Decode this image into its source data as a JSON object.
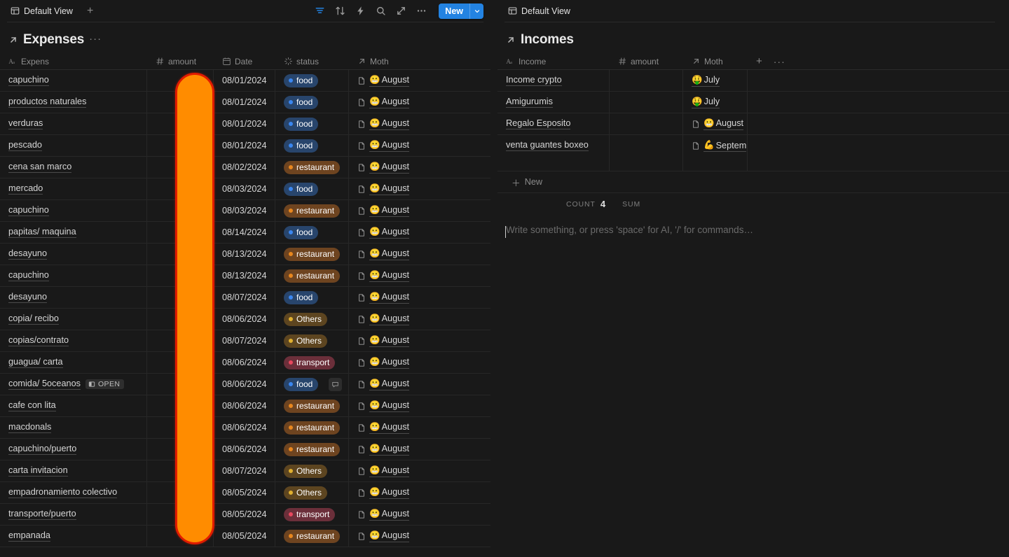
{
  "left": {
    "toolbar": {
      "view_label": "Default View",
      "add_view_label": "+",
      "new_button_label": "New",
      "icons": [
        "filter-icon",
        "sort-icon",
        "automation-icon",
        "search-icon",
        "expand-icon",
        "more-icon"
      ]
    },
    "database": {
      "title": "Expenses",
      "more_label": "···"
    },
    "columns": [
      {
        "label": "Expens",
        "icon": "text-type-icon"
      },
      {
        "label": "amount",
        "icon": "number-type-icon"
      },
      {
        "label": "Date",
        "icon": "date-type-icon"
      },
      {
        "label": "status",
        "icon": "select-type-icon"
      },
      {
        "label": "Moth",
        "icon": "relation-type-icon"
      }
    ],
    "rows": [
      {
        "name": "capuchino",
        "amount": "",
        "date": "08/01/2024",
        "status": "food",
        "status_color": "food",
        "moth": "August",
        "moth_emoji": "😬",
        "comment": false
      },
      {
        "name": "productos naturales",
        "amount": "",
        "date": "08/01/2024",
        "status": "food",
        "status_color": "food",
        "moth": "August",
        "moth_emoji": "😬",
        "comment": false
      },
      {
        "name": "verduras",
        "amount": "",
        "date": "08/01/2024",
        "status": "food",
        "status_color": "food",
        "moth": "August",
        "moth_emoji": "😬",
        "comment": false
      },
      {
        "name": "pescado",
        "amount": "",
        "date": "08/01/2024",
        "status": "food",
        "status_color": "food",
        "moth": "August",
        "moth_emoji": "😬",
        "comment": false
      },
      {
        "name": "cena san marco",
        "amount": "",
        "date": "08/02/2024",
        "status": "restaurant",
        "status_color": "restaurant",
        "moth": "August",
        "moth_emoji": "😬",
        "comment": false
      },
      {
        "name": "mercado",
        "amount": "",
        "date": "08/03/2024",
        "status": "food",
        "status_color": "food",
        "moth": "August",
        "moth_emoji": "😬",
        "comment": false
      },
      {
        "name": "capuchino",
        "amount": "",
        "date": "08/03/2024",
        "status": "restaurant",
        "status_color": "restaurant",
        "moth": "August",
        "moth_emoji": "😬",
        "comment": false
      },
      {
        "name": "papitas/ maquina",
        "amount": "",
        "date": "08/14/2024",
        "status": "food",
        "status_color": "food",
        "moth": "August",
        "moth_emoji": "😬",
        "comment": false
      },
      {
        "name": "desayuno",
        "amount": "",
        "date": "08/13/2024",
        "status": "restaurant",
        "status_color": "restaurant",
        "moth": "August",
        "moth_emoji": "😬",
        "comment": false
      },
      {
        "name": "capuchino",
        "amount": "",
        "date": "08/13/2024",
        "status": "restaurant",
        "status_color": "restaurant",
        "moth": "August",
        "moth_emoji": "😬",
        "comment": false
      },
      {
        "name": "desayuno",
        "amount": "",
        "date": "08/07/2024",
        "status": "food",
        "status_color": "food",
        "moth": "August",
        "moth_emoji": "😬",
        "comment": false
      },
      {
        "name": "copia/ recibo",
        "amount": "",
        "date": "08/06/2024",
        "status": "Others",
        "status_color": "others",
        "moth": "August",
        "moth_emoji": "😬",
        "comment": false
      },
      {
        "name": "copias/contrato",
        "amount": "",
        "date": "08/07/2024",
        "status": "Others",
        "status_color": "others",
        "moth": "August",
        "moth_emoji": "😬",
        "comment": false
      },
      {
        "name": "guagua/ carta",
        "amount": "",
        "date": "08/06/2024",
        "status": "transport",
        "status_color": "transport",
        "moth": "August",
        "moth_emoji": "😬",
        "comment": false
      },
      {
        "name": "comida/ 5oceanos",
        "amount": "",
        "date": "08/06/2024",
        "status": "food",
        "status_color": "food",
        "moth": "August",
        "moth_emoji": "😬",
        "comment": true,
        "badge": "OPEN"
      },
      {
        "name": "cafe con lita",
        "amount": "",
        "date": "08/06/2024",
        "status": "restaurant",
        "status_color": "restaurant",
        "moth": "August",
        "moth_emoji": "😬",
        "comment": false
      },
      {
        "name": "macdonals",
        "amount": "",
        "date": "08/06/2024",
        "status": "restaurant",
        "status_color": "restaurant",
        "moth": "August",
        "moth_emoji": "😬",
        "comment": false
      },
      {
        "name": "capuchino/puerto",
        "amount": "",
        "date": "08/06/2024",
        "status": "restaurant",
        "status_color": "restaurant",
        "moth": "August",
        "moth_emoji": "😬",
        "comment": false
      },
      {
        "name": "carta invitacion",
        "amount": "",
        "date": "08/07/2024",
        "status": "Others",
        "status_color": "others",
        "moth": "August",
        "moth_emoji": "😬",
        "comment": false
      },
      {
        "name": "empadronamiento colectivo",
        "amount": "",
        "date": "08/05/2024",
        "status": "Others",
        "status_color": "others",
        "moth": "August",
        "moth_emoji": "😬",
        "comment": false
      },
      {
        "name": "transporte/puerto",
        "amount": "",
        "date": "08/05/2024",
        "status": "transport",
        "status_color": "transport",
        "moth": "August",
        "moth_emoji": "😬",
        "comment": false
      },
      {
        "name": "empanada",
        "amount": "",
        "date": "08/05/2024",
        "status": "restaurant",
        "status_color": "restaurant",
        "moth": "August",
        "moth_emoji": "😬",
        "comment": false
      }
    ]
  },
  "right": {
    "toolbar": {
      "view_label": "Default View"
    },
    "database": {
      "title": "Incomes"
    },
    "columns": [
      {
        "label": "Income",
        "icon": "text-type-icon"
      },
      {
        "label": "amount",
        "icon": "number-type-icon"
      },
      {
        "label": "Moth",
        "icon": "relation-type-icon"
      }
    ],
    "add_column_label": "+",
    "more_columns_label": "···",
    "rows": [
      {
        "name": "Income crypto",
        "amount": "",
        "moth": "July",
        "moth_emoji": "🤑",
        "page_icon": false
      },
      {
        "name": "Amigurumis",
        "amount": "",
        "moth": "July",
        "moth_emoji": "🤑",
        "page_icon": false
      },
      {
        "name": "Regalo Esposito",
        "amount": "",
        "moth": "August",
        "moth_emoji": "😬",
        "page_icon": true
      },
      {
        "name": "venta guantes boxeo",
        "amount": "",
        "moth": "Septem",
        "moth_emoji": "💪",
        "page_icon": true
      }
    ],
    "new_row_label": "New",
    "aggregation": {
      "count_label": "COUNT",
      "count_value": "4",
      "sum_label": "SUM",
      "sum_value": ""
    },
    "editor_placeholder": "Write something, or press 'space' for AI, '/' for commands…"
  },
  "colors": {
    "background": "#191919",
    "accent_blue": "#2383e2",
    "redaction_fill": "#ff8c00",
    "redaction_stroke": "#e01b00",
    "border": "#272727",
    "text_primary": "#d6d6d6",
    "text_muted": "#8e8e8e"
  }
}
